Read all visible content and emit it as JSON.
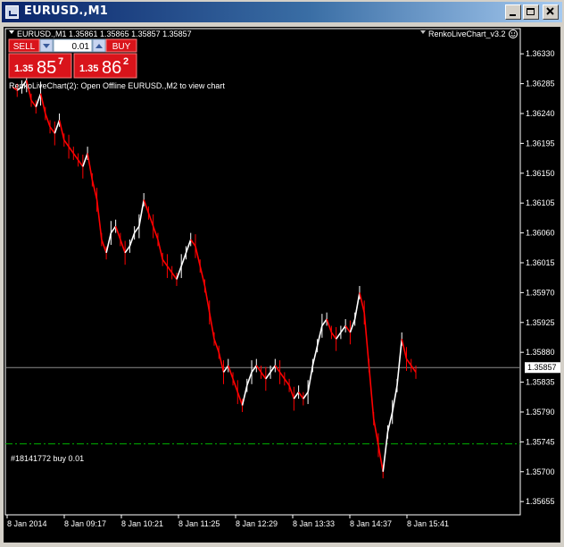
{
  "window": {
    "title": "EURUSD.,M1",
    "minimize_icon": "minimize-icon",
    "maximize_icon": "maximize-icon",
    "close_icon": "close-icon"
  },
  "chart_header": {
    "symbol_line": "EURUSD.,M1  1.35861 1.35865 1.35857 1.35857",
    "indicator_name": "RenkoLiveChart_v3.2",
    "message": "RenkoLiveChart(2): Open Offline EURUSD.,M2 to view chart"
  },
  "trade_panel": {
    "sell_label": "SELL",
    "buy_label": "BUY",
    "lot_value": "0.01",
    "sell_prefix": "1.35",
    "sell_big": "85",
    "sell_sup": "7",
    "buy_prefix": "1.35",
    "buy_big": "86",
    "buy_sup": "2",
    "colors": {
      "panel": "#d9141b",
      "label": "#ffffff"
    }
  },
  "order_line_label": "#18141772 buy 0.01",
  "current_price": "1.35857",
  "price_axis_labels": [
    "1.36330",
    "1.36285",
    "1.36240",
    "1.36195",
    "1.36150",
    "1.36105",
    "1.36060",
    "1.36015",
    "1.35970",
    "1.35925",
    "1.35880",
    "1.35835",
    "1.35790",
    "1.35745",
    "1.35700",
    "1.35655"
  ],
  "time_axis_labels": [
    "8 Jan 2014",
    "8 Jan 09:17",
    "8 Jan 10:21",
    "8 Jan 11:25",
    "8 Jan 12:29",
    "8 Jan 13:33",
    "8 Jan 14:37",
    "8 Jan 15:41"
  ],
  "chart_data": {
    "type": "line",
    "title": "",
    "xlabel": "",
    "ylabel": "",
    "ylim": [
      1.3563,
      1.3636
    ],
    "grid": false,
    "current_price": 1.35857,
    "order_price": 1.35742,
    "colors": {
      "up": "#ffffff",
      "down": "#ff0000",
      "price_line": "#8c8c8c",
      "order_line": "#00b000"
    },
    "x": [
      "8 Jan 2014",
      "8 Jan 09:17",
      "8 Jan 10:21",
      "8 Jan 11:25",
      "8 Jan 12:29",
      "8 Jan 13:33",
      "8 Jan 14:37",
      "8 Jan 15:41"
    ],
    "series": [
      {
        "values": [
          1.3628,
          1.36275,
          1.3628,
          1.3629,
          1.3626,
          1.3625,
          1.3627,
          1.3624,
          1.3622,
          1.3621,
          1.3623,
          1.362,
          1.3619,
          1.3618,
          1.3617,
          1.3616,
          1.3618,
          1.3614,
          1.3611,
          1.3605,
          1.3603,
          1.3606,
          1.3607,
          1.3605,
          1.3603,
          1.3604,
          1.3606,
          1.3607,
          1.3611,
          1.3609,
          1.3607,
          1.3605,
          1.3602,
          1.3601,
          1.36,
          1.3599,
          1.3601,
          1.3603,
          1.3605,
          1.3604,
          1.3601,
          1.3598,
          1.3594,
          1.359,
          1.3588,
          1.3585,
          1.3586,
          1.3584,
          1.3582,
          1.358,
          1.3583,
          1.3585,
          1.3586,
          1.3585,
          1.3584,
          1.3585,
          1.3586,
          1.3585,
          1.3584,
          1.3583,
          1.3581,
          1.3582,
          1.3581,
          1.3582,
          1.3586,
          1.3589,
          1.3592,
          1.3593,
          1.3591,
          1.359,
          1.3591,
          1.3592,
          1.3591,
          1.3593,
          1.3597,
          1.3594,
          1.3586,
          1.3578,
          1.3574,
          1.357,
          1.3576,
          1.3579,
          1.3583,
          1.359,
          1.3587,
          1.3586,
          1.3585
        ]
      }
    ]
  }
}
